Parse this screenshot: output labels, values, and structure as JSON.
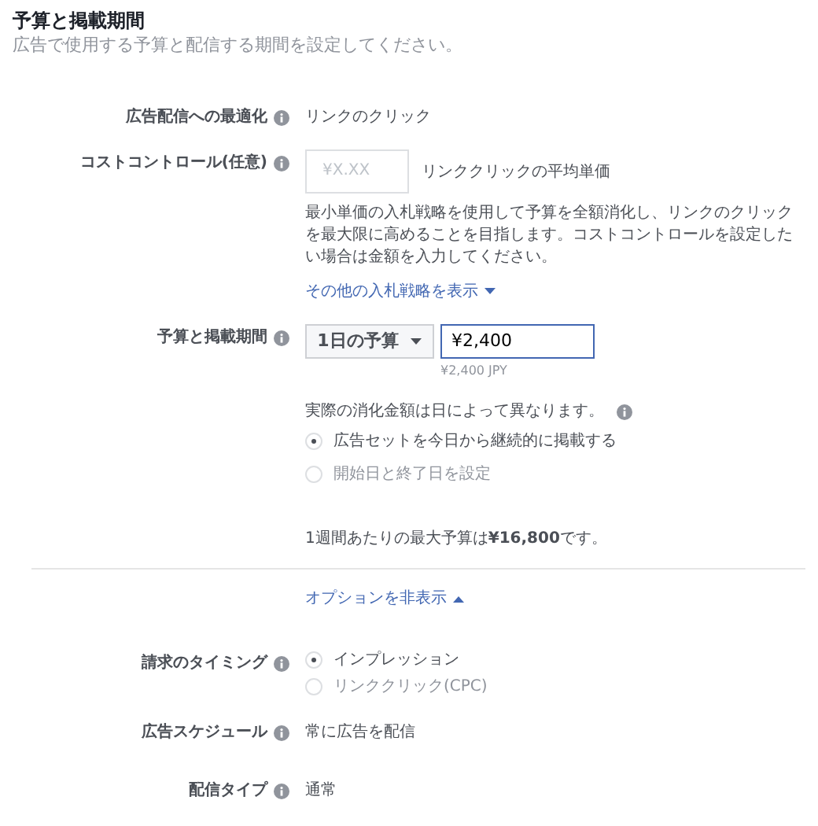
{
  "section": {
    "title": "予算と掲載期間",
    "subtitle": "広告で使用する予算と配信する期間を設定してください。"
  },
  "rows": [
    {
      "kind": "text",
      "label": "広告配信への最適化",
      "value": "リンクのクリック"
    },
    {
      "kind": "cost",
      "label": "コストコントロール(任意)",
      "placeholder": "¥X.XX",
      "unit": "リンククリックの平均単価",
      "description": "最小単価の入札戦略を使用して予算を全額消化し、リンクのクリックを最大限に高めることを目指します。コストコントロールを設定したい場合は金額を入力してください。",
      "link": {
        "label": "その他の入札戦略を表示",
        "expanded": false
      }
    },
    {
      "kind": "budget",
      "label": "予算と掲載期間",
      "dropdown": "1日の予算",
      "value": "¥2,400",
      "converted": "¥2,400 JPY",
      "note": "実際の消化金額は日によって異なります。",
      "options": [
        {
          "label": "広告セットを今日から継続的に掲載する",
          "selected": true
        },
        {
          "label": "開始日と終了日を設定",
          "selected": false
        }
      ],
      "weekly": "1週間あたりの最大予算は**¥16,800**です。"
    }
  ],
  "options_toggle": {
    "label": "オプションを非表示",
    "expanded": true
  },
  "more_rows": [
    {
      "kind": "radio",
      "label": "請求のタイミング",
      "options": [
        {
          "label": "インプレッション",
          "selected": true
        },
        {
          "label": "リンククリック(CPC)",
          "selected": false
        }
      ]
    },
    {
      "kind": "text",
      "label": "広告スケジュール",
      "value": "常に広告を配信"
    },
    {
      "kind": "text",
      "label": "配信タイプ",
      "value": "通常"
    }
  ]
}
